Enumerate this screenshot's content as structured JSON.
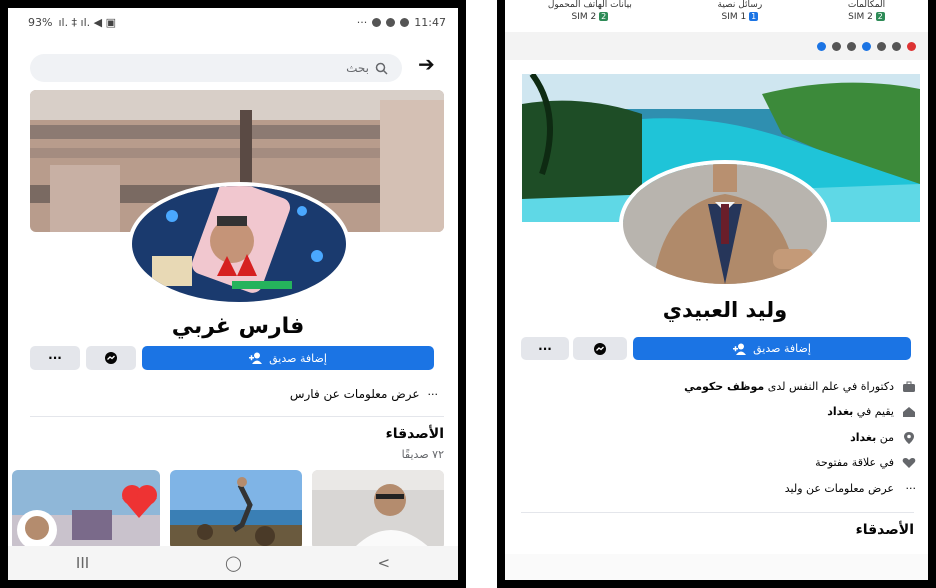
{
  "left": {
    "status": {
      "battery": "93%",
      "time": "11:47",
      "signal": "ıl. ‡ ıl. ◀ ▣",
      "dots": "···"
    },
    "search": {
      "placeholder": "بحث"
    },
    "profile": {
      "name": "فارس غربي"
    },
    "actions": {
      "add_friend": "إضافة صديق",
      "more": "···"
    },
    "about_link": "عرض معلومات عن فارس",
    "about_dots": "···",
    "friends": {
      "title": "الأصدقاء",
      "count": "٧٢ صديقًا"
    },
    "navbar": [
      "III",
      "◯",
      "<"
    ]
  },
  "right": {
    "sim": [
      {
        "label": "بيانات الهاتف المحمول",
        "sim": "SIM 2"
      },
      {
        "label": "رسائل نصية",
        "sim": "SIM 1"
      },
      {
        "label": "المكالمات",
        "sim": "SIM 2"
      }
    ],
    "profile": {
      "name": "وليد العبيدي"
    },
    "actions": {
      "add_friend": "إضافة صديق",
      "more": "···"
    },
    "info": [
      {
        "icon": "briefcase-icon",
        "text": "دكتوراة في علم النفس لدى ",
        "bold": "موظف حكومي"
      },
      {
        "icon": "home-icon",
        "text": "يقيم في ",
        "bold": "بغداد"
      },
      {
        "icon": "location-pin-icon",
        "text": "من ",
        "bold": "بغداد"
      },
      {
        "icon": "heart-icon",
        "text": "في علاقة مفتوحة",
        "bold": ""
      },
      {
        "icon": "more-dots-icon",
        "text": "عرض معلومات عن وليد",
        "bold": ""
      }
    ],
    "friends": {
      "title": "الأصدقاء"
    }
  },
  "colors": {
    "primary": "#1b74e4",
    "gray_button": "#e4e6eb",
    "text": "#050505",
    "muted": "#65676b"
  }
}
